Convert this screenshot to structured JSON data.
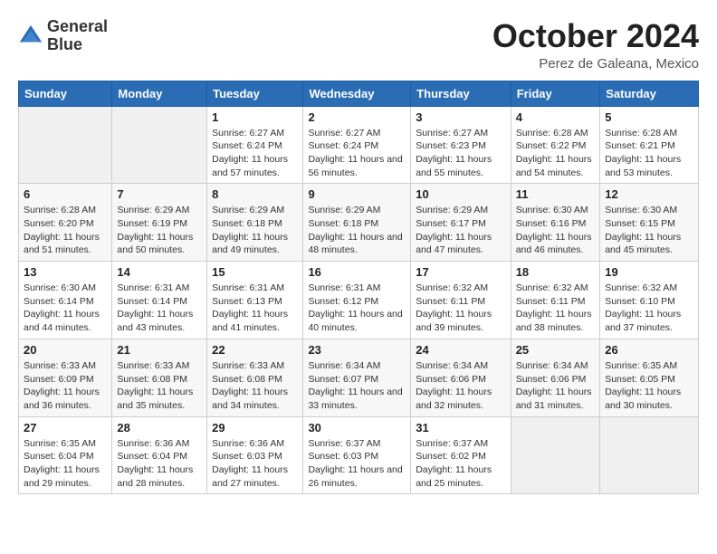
{
  "header": {
    "logo_line1": "General",
    "logo_line2": "Blue",
    "month_title": "October 2024",
    "location": "Perez de Galeana, Mexico"
  },
  "days_of_week": [
    "Sunday",
    "Monday",
    "Tuesday",
    "Wednesday",
    "Thursday",
    "Friday",
    "Saturday"
  ],
  "weeks": [
    [
      {
        "day": "",
        "sunrise": "",
        "sunset": "",
        "daylight": ""
      },
      {
        "day": "",
        "sunrise": "",
        "sunset": "",
        "daylight": ""
      },
      {
        "day": "1",
        "sunrise": "Sunrise: 6:27 AM",
        "sunset": "Sunset: 6:24 PM",
        "daylight": "Daylight: 11 hours and 57 minutes."
      },
      {
        "day": "2",
        "sunrise": "Sunrise: 6:27 AM",
        "sunset": "Sunset: 6:24 PM",
        "daylight": "Daylight: 11 hours and 56 minutes."
      },
      {
        "day": "3",
        "sunrise": "Sunrise: 6:27 AM",
        "sunset": "Sunset: 6:23 PM",
        "daylight": "Daylight: 11 hours and 55 minutes."
      },
      {
        "day": "4",
        "sunrise": "Sunrise: 6:28 AM",
        "sunset": "Sunset: 6:22 PM",
        "daylight": "Daylight: 11 hours and 54 minutes."
      },
      {
        "day": "5",
        "sunrise": "Sunrise: 6:28 AM",
        "sunset": "Sunset: 6:21 PM",
        "daylight": "Daylight: 11 hours and 53 minutes."
      }
    ],
    [
      {
        "day": "6",
        "sunrise": "Sunrise: 6:28 AM",
        "sunset": "Sunset: 6:20 PM",
        "daylight": "Daylight: 11 hours and 51 minutes."
      },
      {
        "day": "7",
        "sunrise": "Sunrise: 6:29 AM",
        "sunset": "Sunset: 6:19 PM",
        "daylight": "Daylight: 11 hours and 50 minutes."
      },
      {
        "day": "8",
        "sunrise": "Sunrise: 6:29 AM",
        "sunset": "Sunset: 6:18 PM",
        "daylight": "Daylight: 11 hours and 49 minutes."
      },
      {
        "day": "9",
        "sunrise": "Sunrise: 6:29 AM",
        "sunset": "Sunset: 6:18 PM",
        "daylight": "Daylight: 11 hours and 48 minutes."
      },
      {
        "day": "10",
        "sunrise": "Sunrise: 6:29 AM",
        "sunset": "Sunset: 6:17 PM",
        "daylight": "Daylight: 11 hours and 47 minutes."
      },
      {
        "day": "11",
        "sunrise": "Sunrise: 6:30 AM",
        "sunset": "Sunset: 6:16 PM",
        "daylight": "Daylight: 11 hours and 46 minutes."
      },
      {
        "day": "12",
        "sunrise": "Sunrise: 6:30 AM",
        "sunset": "Sunset: 6:15 PM",
        "daylight": "Daylight: 11 hours and 45 minutes."
      }
    ],
    [
      {
        "day": "13",
        "sunrise": "Sunrise: 6:30 AM",
        "sunset": "Sunset: 6:14 PM",
        "daylight": "Daylight: 11 hours and 44 minutes."
      },
      {
        "day": "14",
        "sunrise": "Sunrise: 6:31 AM",
        "sunset": "Sunset: 6:14 PM",
        "daylight": "Daylight: 11 hours and 43 minutes."
      },
      {
        "day": "15",
        "sunrise": "Sunrise: 6:31 AM",
        "sunset": "Sunset: 6:13 PM",
        "daylight": "Daylight: 11 hours and 41 minutes."
      },
      {
        "day": "16",
        "sunrise": "Sunrise: 6:31 AM",
        "sunset": "Sunset: 6:12 PM",
        "daylight": "Daylight: 11 hours and 40 minutes."
      },
      {
        "day": "17",
        "sunrise": "Sunrise: 6:32 AM",
        "sunset": "Sunset: 6:11 PM",
        "daylight": "Daylight: 11 hours and 39 minutes."
      },
      {
        "day": "18",
        "sunrise": "Sunrise: 6:32 AM",
        "sunset": "Sunset: 6:11 PM",
        "daylight": "Daylight: 11 hours and 38 minutes."
      },
      {
        "day": "19",
        "sunrise": "Sunrise: 6:32 AM",
        "sunset": "Sunset: 6:10 PM",
        "daylight": "Daylight: 11 hours and 37 minutes."
      }
    ],
    [
      {
        "day": "20",
        "sunrise": "Sunrise: 6:33 AM",
        "sunset": "Sunset: 6:09 PM",
        "daylight": "Daylight: 11 hours and 36 minutes."
      },
      {
        "day": "21",
        "sunrise": "Sunrise: 6:33 AM",
        "sunset": "Sunset: 6:08 PM",
        "daylight": "Daylight: 11 hours and 35 minutes."
      },
      {
        "day": "22",
        "sunrise": "Sunrise: 6:33 AM",
        "sunset": "Sunset: 6:08 PM",
        "daylight": "Daylight: 11 hours and 34 minutes."
      },
      {
        "day": "23",
        "sunrise": "Sunrise: 6:34 AM",
        "sunset": "Sunset: 6:07 PM",
        "daylight": "Daylight: 11 hours and 33 minutes."
      },
      {
        "day": "24",
        "sunrise": "Sunrise: 6:34 AM",
        "sunset": "Sunset: 6:06 PM",
        "daylight": "Daylight: 11 hours and 32 minutes."
      },
      {
        "day": "25",
        "sunrise": "Sunrise: 6:34 AM",
        "sunset": "Sunset: 6:06 PM",
        "daylight": "Daylight: 11 hours and 31 minutes."
      },
      {
        "day": "26",
        "sunrise": "Sunrise: 6:35 AM",
        "sunset": "Sunset: 6:05 PM",
        "daylight": "Daylight: 11 hours and 30 minutes."
      }
    ],
    [
      {
        "day": "27",
        "sunrise": "Sunrise: 6:35 AM",
        "sunset": "Sunset: 6:04 PM",
        "daylight": "Daylight: 11 hours and 29 minutes."
      },
      {
        "day": "28",
        "sunrise": "Sunrise: 6:36 AM",
        "sunset": "Sunset: 6:04 PM",
        "daylight": "Daylight: 11 hours and 28 minutes."
      },
      {
        "day": "29",
        "sunrise": "Sunrise: 6:36 AM",
        "sunset": "Sunset: 6:03 PM",
        "daylight": "Daylight: 11 hours and 27 minutes."
      },
      {
        "day": "30",
        "sunrise": "Sunrise: 6:37 AM",
        "sunset": "Sunset: 6:03 PM",
        "daylight": "Daylight: 11 hours and 26 minutes."
      },
      {
        "day": "31",
        "sunrise": "Sunrise: 6:37 AM",
        "sunset": "Sunset: 6:02 PM",
        "daylight": "Daylight: 11 hours and 25 minutes."
      },
      {
        "day": "",
        "sunrise": "",
        "sunset": "",
        "daylight": ""
      },
      {
        "day": "",
        "sunrise": "",
        "sunset": "",
        "daylight": ""
      }
    ]
  ]
}
